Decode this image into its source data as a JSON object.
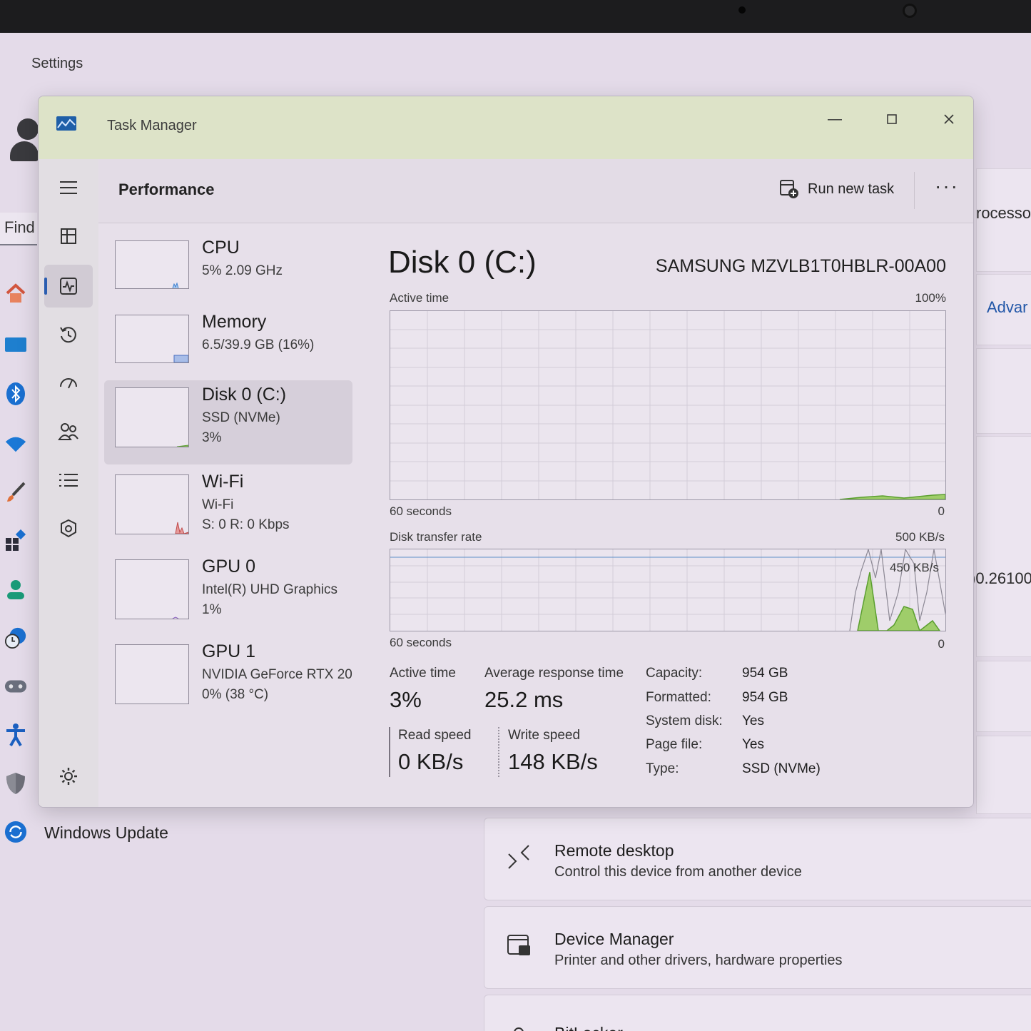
{
  "settings": {
    "title": "Settings",
    "find_placeholder": "Find",
    "windows_update": "Windows Update",
    "right_partial_1": "rocesso",
    "right_partial_2": "Advar",
    "right_partial_3": ")0.26100",
    "cards": [
      {
        "title": "Remote desktop",
        "subtitle": "Control this device from another device"
      },
      {
        "title": "Device Manager",
        "subtitle": "Printer and other drivers, hardware properties"
      },
      {
        "title": "BitLocker",
        "subtitle": ""
      }
    ]
  },
  "taskmanager": {
    "title": "Task Manager",
    "header_title": "Performance",
    "run_new_task": "Run new task",
    "more": "···",
    "devices": [
      {
        "name": "CPU",
        "line1": "5%  2.09 GHz",
        "line2": ""
      },
      {
        "name": "Memory",
        "line1": "6.5/39.9 GB (16%)",
        "line2": ""
      },
      {
        "name": "Disk 0 (C:)",
        "line1": "SSD (NVMe)",
        "line2": "3%"
      },
      {
        "name": "Wi-Fi",
        "line1": "Wi-Fi",
        "line2": "S: 0  R: 0 Kbps"
      },
      {
        "name": "GPU 0",
        "line1": "Intel(R) UHD Graphics",
        "line2": "1%"
      },
      {
        "name": "GPU 1",
        "line1": "NVIDIA GeForce RTX 20",
        "line2": "0%  (38 °C)"
      }
    ],
    "detail": {
      "title": "Disk 0 (C:)",
      "model": "SAMSUNG MZVLB1T0HBLR-00A00",
      "graph1": {
        "label": "Active time",
        "max": "100%",
        "x_label": "60 seconds",
        "min": "0"
      },
      "graph2": {
        "label": "Disk transfer rate",
        "max": "500 KB/s",
        "inner": "450 KB/s",
        "x_label": "60 seconds",
        "min": "0"
      },
      "stats": {
        "active_time_label": "Active time",
        "active_time_value": "3%",
        "avg_resp_label": "Average response time",
        "avg_resp_value": "25.2 ms",
        "read_label": "Read speed",
        "read_value": "0 KB/s",
        "write_label": "Write speed",
        "write_value": "148 KB/s"
      },
      "props": [
        {
          "k": "Capacity:",
          "v": "954 GB"
        },
        {
          "k": "Formatted:",
          "v": "954 GB"
        },
        {
          "k": "System disk:",
          "v": "Yes"
        },
        {
          "k": "Page file:",
          "v": "Yes"
        },
        {
          "k": "Type:",
          "v": "SSD (NVMe)"
        }
      ]
    }
  },
  "colors": {
    "graph_fill": "#9fcd6a",
    "graph_line": "#5b9f2f",
    "accent": "#2a5db0"
  }
}
